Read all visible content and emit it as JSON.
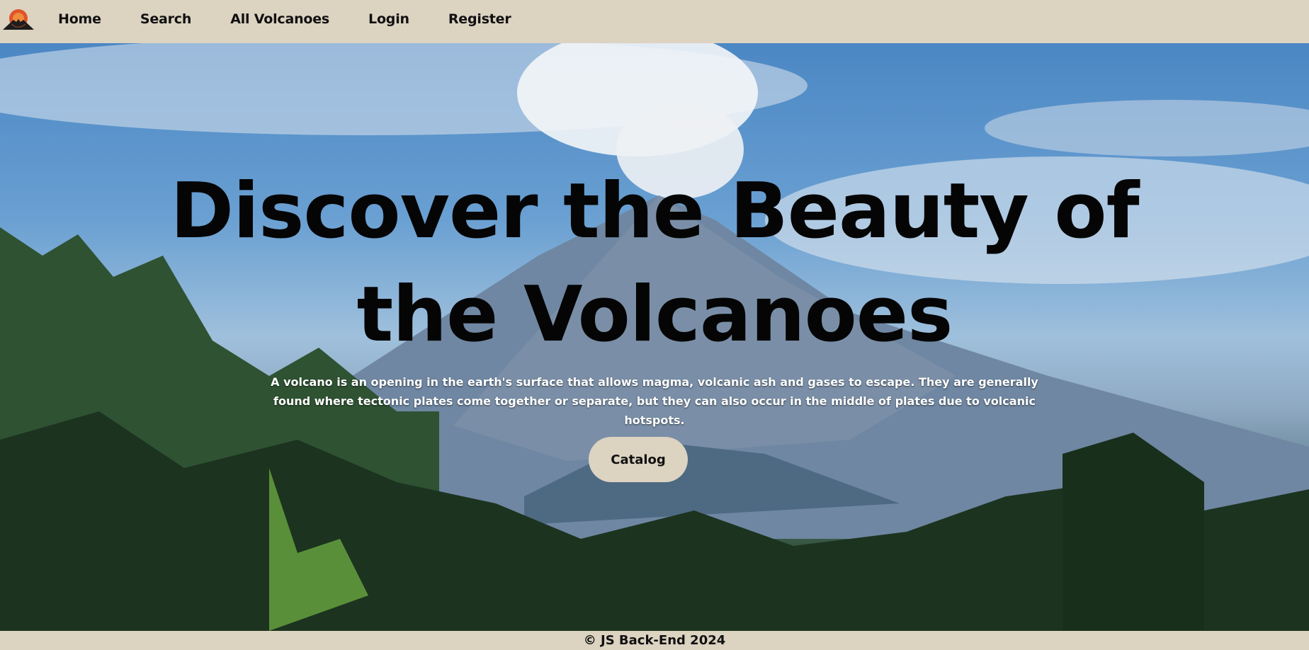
{
  "nav": {
    "logo_icon": "volcano-logo-icon",
    "links": [
      "Home",
      "Search",
      "All Volcanoes",
      "Login",
      "Register"
    ]
  },
  "hero": {
    "title": "Discover the Beauty of the Volcanoes",
    "description": "A volcano is an opening in the earth's surface that allows magma, volcanic ash and gases to escape. They are generally found where tectonic plates come together or separate, but they can also occur in the middle of plates due to volcanic hotspots.",
    "button": "Catalog"
  },
  "footer": {
    "text": "© JS Back-End 2024"
  },
  "colors": {
    "bar_bg": "#dcd3c1",
    "title": "#050505",
    "desc": "#ffffff"
  }
}
